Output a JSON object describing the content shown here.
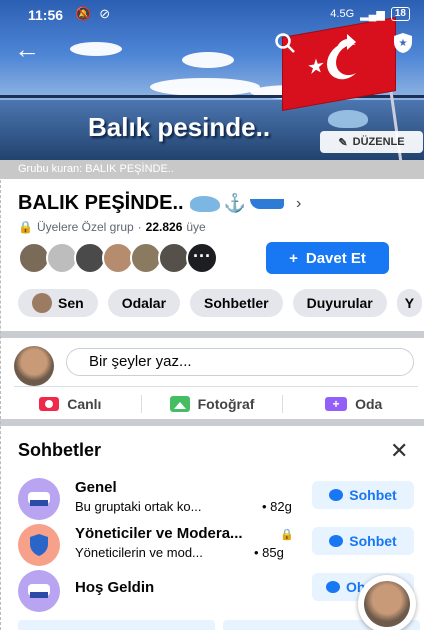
{
  "status_bar": {
    "time": "11:56",
    "network": "4.5G",
    "battery": "18"
  },
  "cover": {
    "title": "Balık pesinde..",
    "edit_label": "DÜZENLE"
  },
  "founder_text": "Grubu kuran: BALIK PEŞİNDE..",
  "group": {
    "name": "BALIK PEŞİNDE..",
    "privacy": "Üyelere Özel grup",
    "members_count": "22.826",
    "members_word": "üye",
    "invite_label": "Davet Et"
  },
  "chips": [
    "Sen",
    "Odalar",
    "Sohbetler",
    "Duyurular"
  ],
  "composer": {
    "placeholder": "Bir şeyler yaz...",
    "actions": [
      "Canlı",
      "Fotoğraf",
      "Oda"
    ]
  },
  "chats": {
    "title": "Sohbetler",
    "items": [
      {
        "name": "Genel",
        "sub": "Bu gruptaki ortak ko...",
        "time": "• 82g",
        "button": "Sohbet",
        "icon": "chat-room-icon"
      },
      {
        "name": "Yöneticiler ve Modera...",
        "sub": "Yöneticilerin ve mod...",
        "time": "• 85g",
        "button": "Sohbet",
        "icon": "shield-icon"
      },
      {
        "name": "Hoş Geldin",
        "sub": "",
        "time": "",
        "button": "Oh",
        "icon": "chat-room-icon"
      }
    ]
  },
  "colors": {
    "primary": "#1877f2",
    "chip_bg": "#e4e6eb",
    "live": "#f02849",
    "photo": "#45bd62",
    "room": "#9360f7"
  }
}
